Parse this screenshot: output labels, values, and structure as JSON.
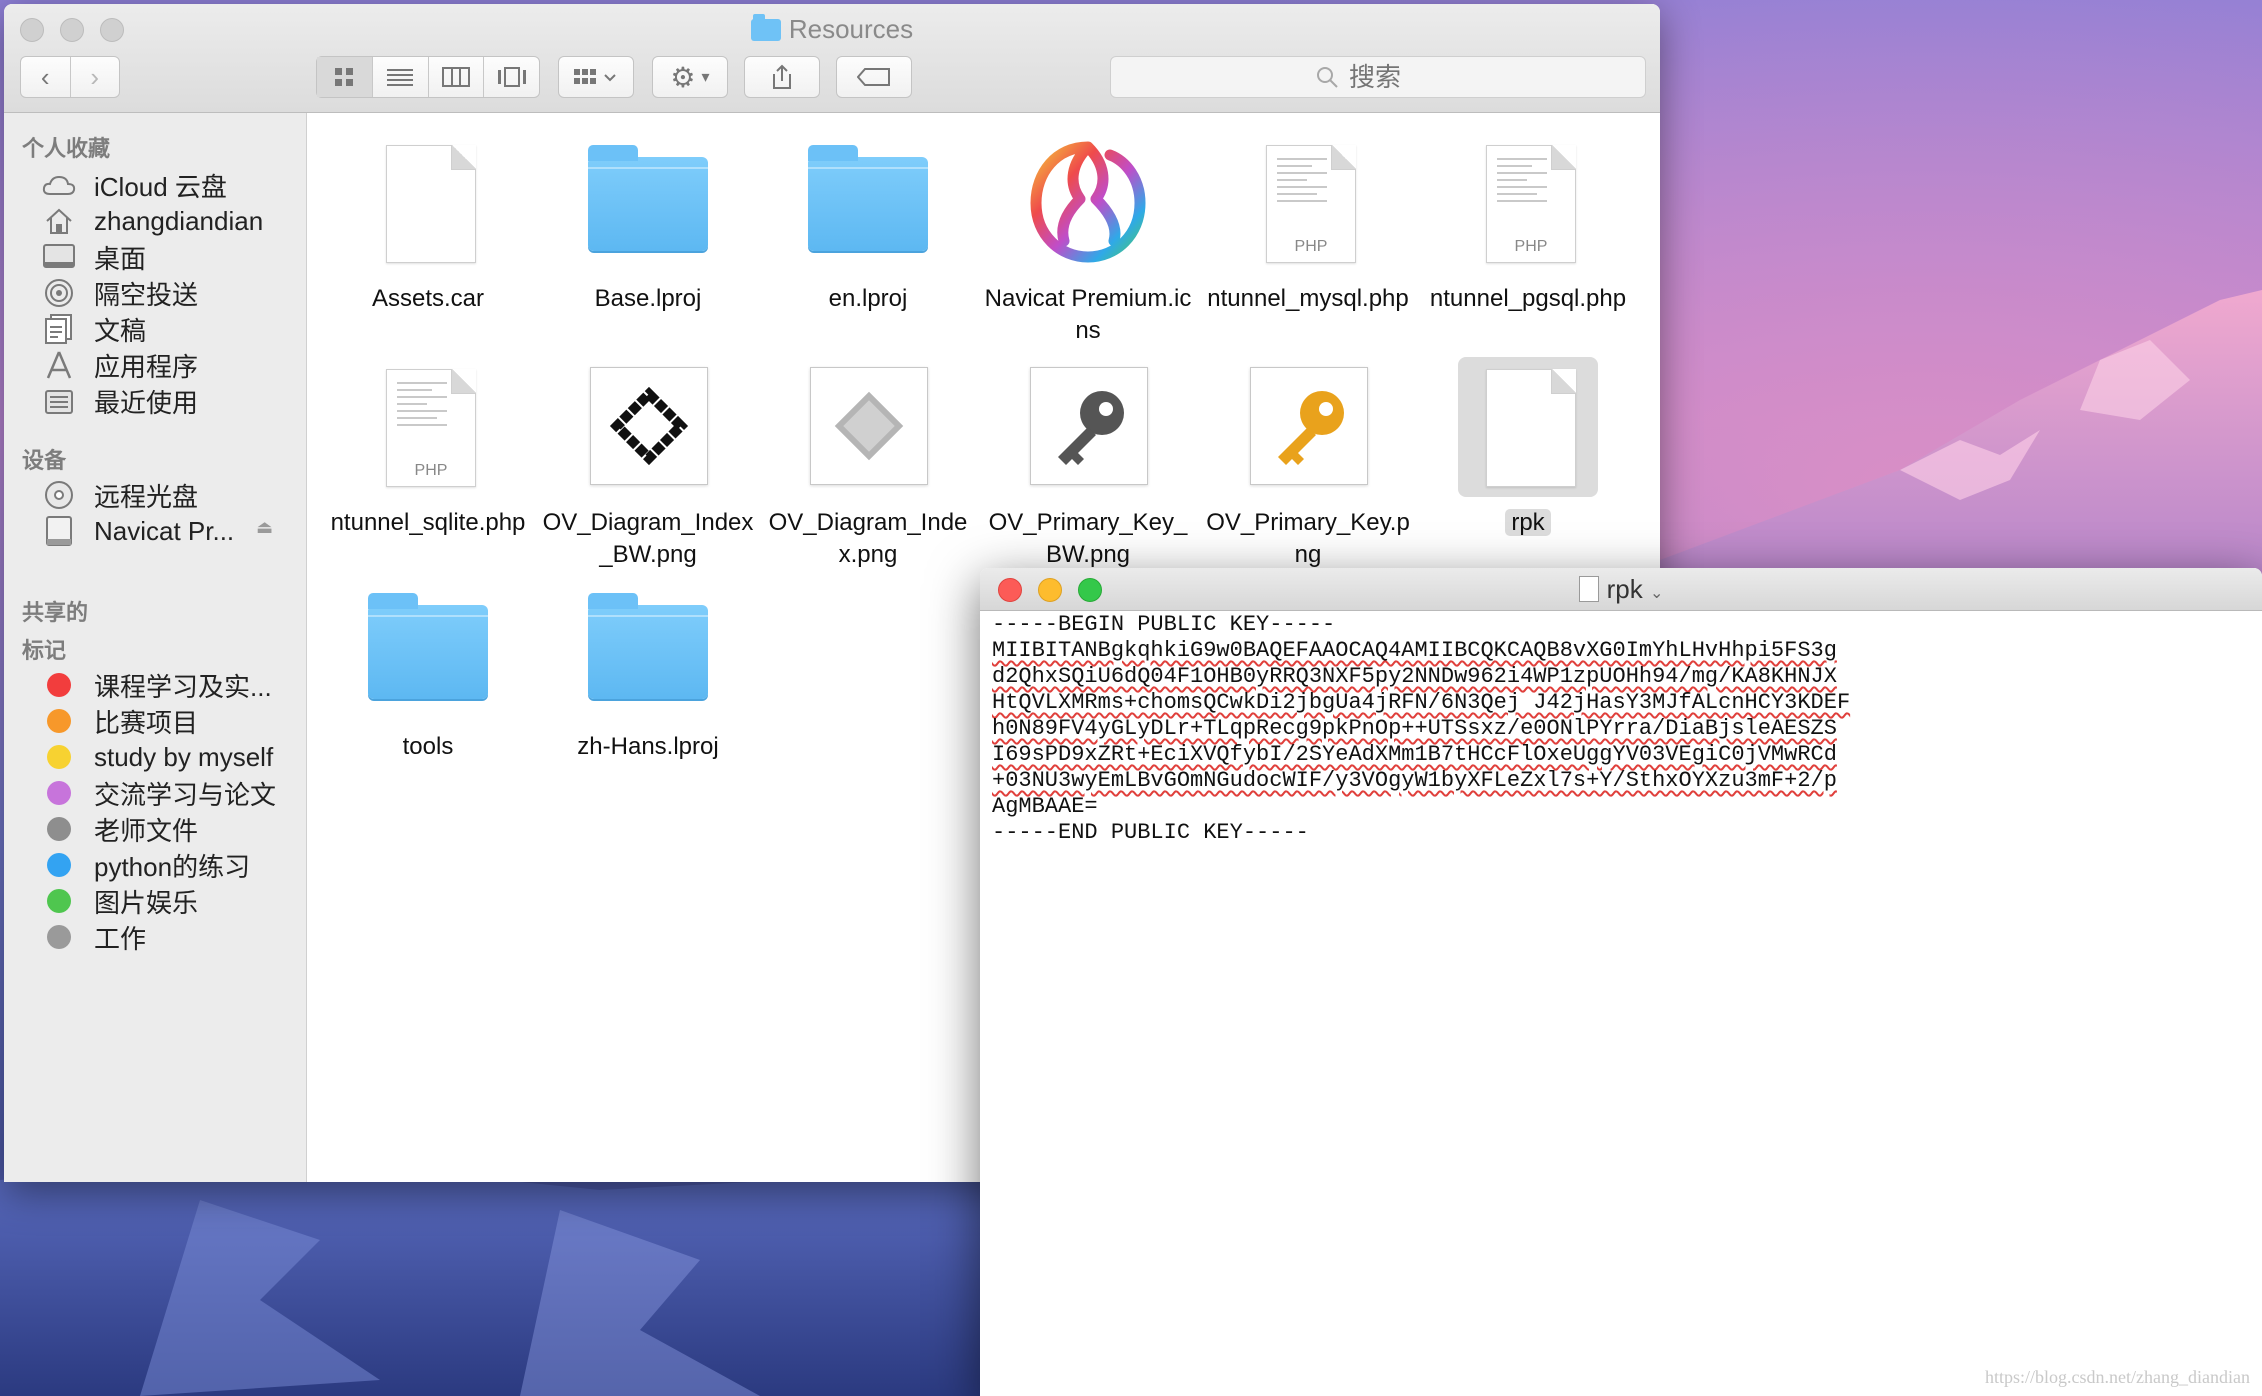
{
  "finder": {
    "title": "Resources",
    "search": {
      "placeholder": "搜索"
    },
    "sidebar": {
      "favorites_heading": "个人收藏",
      "favorites": [
        {
          "label": "iCloud 云盘",
          "icon": "cloud-icon"
        },
        {
          "label": "zhangdiandian",
          "icon": "home-icon"
        },
        {
          "label": "桌面",
          "icon": "desktop-icon"
        },
        {
          "label": "隔空投送",
          "icon": "airdrop-icon"
        },
        {
          "label": "文稿",
          "icon": "documents-icon"
        },
        {
          "label": "应用程序",
          "icon": "applications-icon"
        },
        {
          "label": "最近使用",
          "icon": "recents-icon"
        }
      ],
      "devices_heading": "设备",
      "devices": [
        {
          "label": "远程光盘",
          "icon": "disc-icon"
        },
        {
          "label": "Navicat Pr...",
          "icon": "drive-icon"
        }
      ],
      "shared_heading": "共享的",
      "tags_heading": "标记",
      "tags": [
        {
          "label": "课程学习及实...",
          "color": "#f23d3d"
        },
        {
          "label": "比赛项目",
          "color": "#f7982a"
        },
        {
          "label": "study by myself",
          "color": "#f7d231"
        },
        {
          "label": "交流学习与论文",
          "color": "#c774db"
        },
        {
          "label": "老师文件",
          "color": "#8e8e8e"
        },
        {
          "label": "python的练习",
          "color": "#33a3f2"
        },
        {
          "label": "图片娱乐",
          "color": "#4fc64f"
        },
        {
          "label": "工作",
          "color": "#9a9a9a"
        }
      ]
    },
    "files": [
      {
        "name": "Assets.car",
        "type": "document"
      },
      {
        "name": "Base.lproj",
        "type": "folder"
      },
      {
        "name": "en.lproj",
        "type": "folder"
      },
      {
        "name": "Navicat Premium.icns",
        "type": "navicat"
      },
      {
        "name": "ntunnel_mysql.php",
        "type": "php"
      },
      {
        "name": "ntunnel_pgsql.php",
        "type": "php"
      },
      {
        "name": "ntunnel_sqlite.php",
        "type": "php"
      },
      {
        "name": "OV_Diagram_Index_BW.png",
        "type": "diagram-bw"
      },
      {
        "name": "OV_Diagram_Index.png",
        "type": "diagram"
      },
      {
        "name": "OV_Primary_Key_BW.png",
        "type": "key-bw"
      },
      {
        "name": "OV_Primary_Key.png",
        "type": "key"
      },
      {
        "name": "rpk",
        "type": "document",
        "selected": true
      },
      {
        "name": "tools",
        "type": "folder"
      },
      {
        "name": "zh-Hans.lproj",
        "type": "folder"
      }
    ]
  },
  "textedit": {
    "title": "rpk",
    "lines": [
      "-----BEGIN PUBLIC KEY-----",
      "MIIBITANBgkqhkiG9w0BAQEFAAOCAQ4AMIIBCQKCAQB8vXG0ImYhLHvHhpi5FS3g",
      "d2QhxSQiU6dQ04F1OHB0yRRQ3NXF5py2NNDw962i4WP1zpUOHh94/mg/KA8KHNJX",
      "HtQVLXMRms+chomsQCwkDi2jbgUa4jRFN/6N3Qej J42jHasY3MJfALcnHCY3KDEF",
      "h0N89FV4yGLyDLr+TLqpRecg9pkPnOp++UTSsxz/e0ONlPYrra/DiaBjsleAESZS",
      "I69sPD9xZRt+EciXVQfybI/2SYeAdXMm1B7tHCcFlOxeUggYV03VEgiC0jVMwRCd",
      "+03NU3wyEmLBvGOmNGudocWIF/y3VOgyW1byXFLeZxl7s+Y/SthxOYXzu3mF+2/p",
      "AgMBAAE=",
      "-----END PUBLIC KEY-----"
    ],
    "watermark": "https://blog.csdn.net/zhang_diandian"
  }
}
